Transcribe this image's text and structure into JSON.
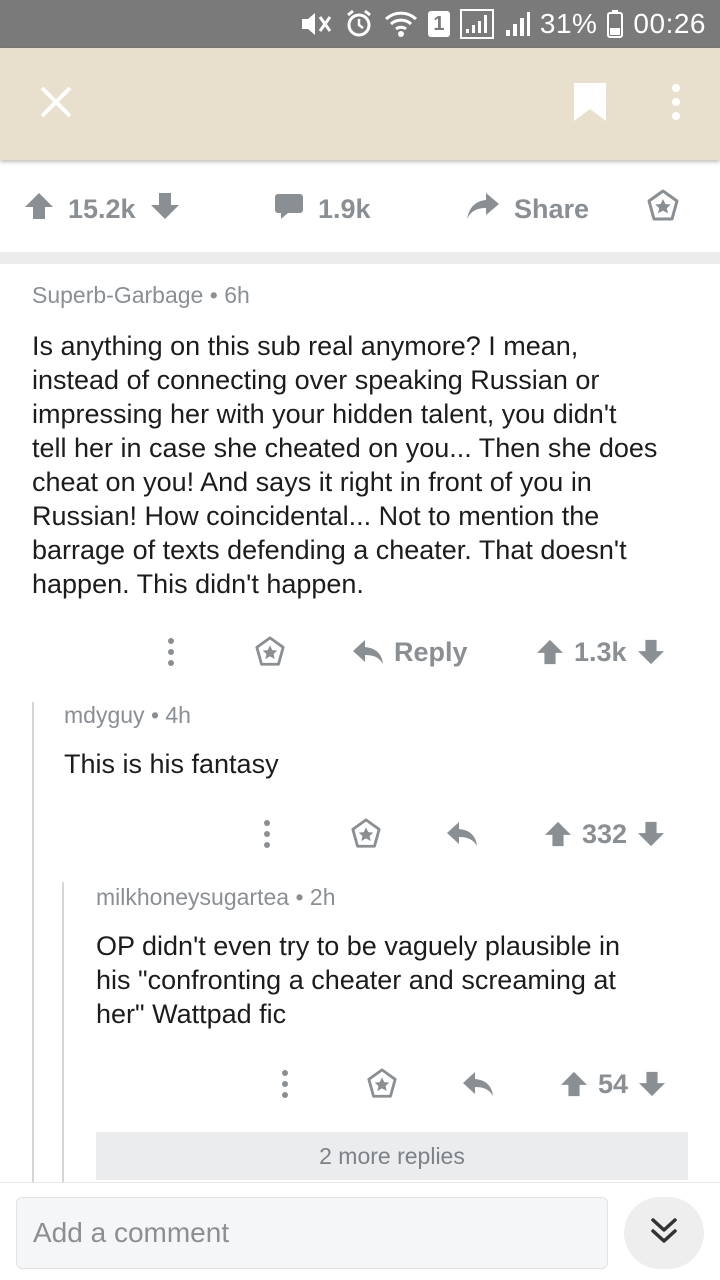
{
  "status_bar": {
    "sim_badge": "1",
    "battery_pct": "31%",
    "time": "00:26"
  },
  "toolbar": {
    "icons": [
      "close-icon",
      "bookmark-icon",
      "overflow-menu-icon"
    ]
  },
  "post_actions": {
    "score": "15.2k",
    "comments": "1.9k",
    "share_label": "Share"
  },
  "comments": [
    {
      "author": "Superb-Garbage",
      "separator": "•",
      "age": "6h",
      "body_lines": [
        "Is anything on this sub real anymore? I mean,",
        "instead of connecting over speaking Russian or",
        "impressing her with your hidden talent, you didn't",
        "tell her in case she cheated on you... Then she does",
        "cheat on you! And says it right in front of you in",
        "Russian! How coincidental... Not to mention the",
        "barrage of texts defending a cheater. That doesn't",
        "happen. This didn't happen."
      ],
      "reply_label": "Reply",
      "score": "1.3k"
    },
    {
      "author": "mdyguy",
      "separator": "•",
      "age": "4h",
      "body_lines": [
        "This is his fantasy"
      ],
      "score": "332"
    },
    {
      "author": "milkhoneysugartea",
      "separator": "•",
      "age": "2h",
      "body_lines": [
        "OP didn't even try to be vaguely plausible in",
        "his \"confronting a cheater and screaming at",
        "her\" Wattpad fic"
      ],
      "score": "54"
    }
  ],
  "more_replies": "2 more replies",
  "composer": {
    "placeholder": "Add a comment"
  },
  "colors": {
    "toolbar": "#e9dfcd",
    "status_bar": "#7a7a7a",
    "muted": "#8a8f94",
    "text": "#1c1c1c"
  }
}
